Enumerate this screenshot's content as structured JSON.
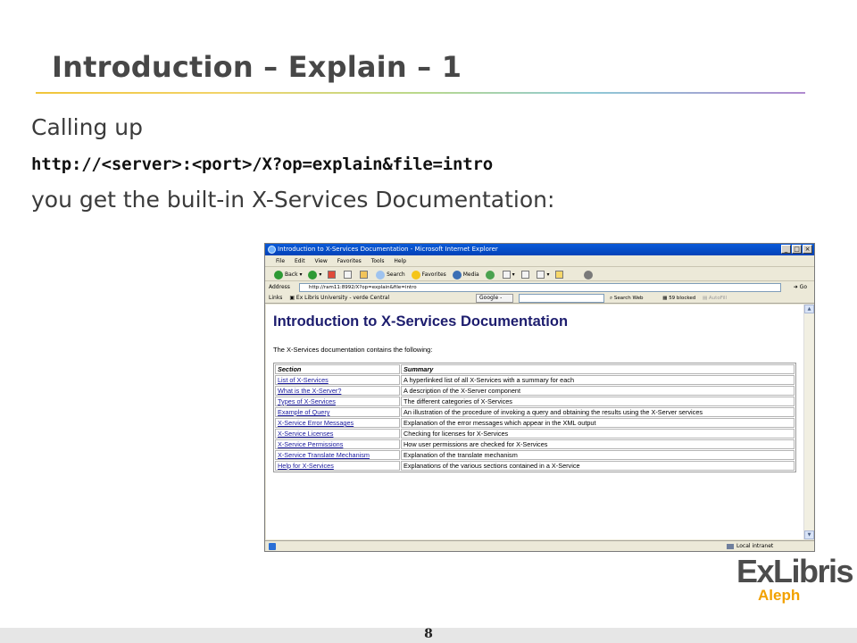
{
  "slide": {
    "title": "Introduction – Explain – 1",
    "line1": "Calling up",
    "url": "http://<server>:<port>/X?op=explain&file=intro",
    "line3": "you get the built-in X-Services Documentation:",
    "page_number": "8"
  },
  "logo": {
    "brand": "ExLibris",
    "product": "Aleph"
  },
  "ie": {
    "window_title": "Introduction to X-Services Documentation - Microsoft Internet Explorer",
    "menu": [
      "File",
      "Edit",
      "View",
      "Favorites",
      "Tools",
      "Help"
    ],
    "toolbar": {
      "back": "Back",
      "search": "Search",
      "favorites": "Favorites",
      "media": "Media"
    },
    "address_label": "Address",
    "address_value": "http://ram11:8992/X?op=explain&file=intro",
    "go_label": "Go",
    "links_label": "Links",
    "links_item": "Ex Libris University - verde Central",
    "google_label": "Google -",
    "search_web": "Search Web",
    "blocked": "59 blocked",
    "autofill": "AutoFill",
    "status_zone": "Local intranet"
  },
  "doc": {
    "title": "Introduction to X-Services Documentation",
    "intro": "The X-Services documentation contains the following:",
    "headers": {
      "section": "Section",
      "summary": "Summary"
    },
    "rows": [
      {
        "section": "List of X-Services",
        "summary": "A hyperlinked list of all X-Services with a summary for each"
      },
      {
        "section": "What is the X-Server?",
        "summary": "A description of the X-Server component"
      },
      {
        "section": "Types of X-Services",
        "summary": "The different categories of X-Services"
      },
      {
        "section": "Example of Query",
        "summary": "An illustration of the procedure of invoking a query and obtaining the results using the X-Server services"
      },
      {
        "section": "X-Service Error Messages",
        "summary": "Explanation of the error messages which appear in the XML output"
      },
      {
        "section": "X-Service Licenses",
        "summary": "Checking for licenses for X-Services"
      },
      {
        "section": "X-Service Permissions",
        "summary": "How user permissions are checked for X-Services"
      },
      {
        "section": "X-Service Translate Mechanism",
        "summary": "Explanation of the translate mechanism"
      },
      {
        "section": "Help for X-Services",
        "summary": "Explanations of the various sections contained in a X-Service"
      }
    ]
  },
  "colors": {
    "title_text": "#474747",
    "doc_heading": "#1d1d6e",
    "link": "#1a1a9e",
    "aleph_orange": "#f2a100",
    "ie_titlebar": "#0a5ad8"
  }
}
